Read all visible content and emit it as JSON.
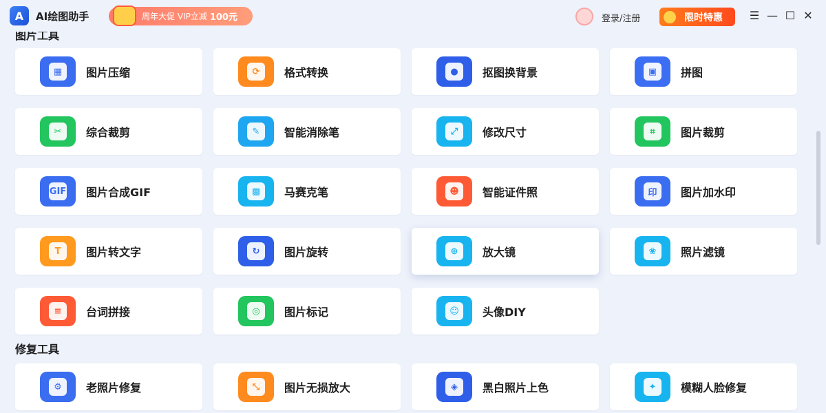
{
  "app": {
    "logo_letter": "A",
    "title": "AI绘图助手",
    "promo_text": "周年大促 VIP立减",
    "promo_amount": "100元",
    "login_label": "登录/注册",
    "offer_label": "限时特惠"
  },
  "window_controls": {
    "menu": "☰",
    "minimize": "—",
    "maximize": "☐",
    "close": "✕"
  },
  "sections": [
    {
      "title": "图片工具",
      "items": [
        {
          "label": "图片压缩",
          "icon": "file-compress-icon",
          "color": "#3a6df0",
          "glyph": "▦"
        },
        {
          "label": "格式转换",
          "icon": "format-convert-icon",
          "color": "#ff8a1e",
          "glyph": "⟳"
        },
        {
          "label": "抠图换背景",
          "icon": "cutout-icon",
          "color": "#2f5fe8",
          "glyph": "●"
        },
        {
          "label": "拼图",
          "icon": "puzzle-icon",
          "color": "#3b6ef2",
          "glyph": "▣"
        },
        {
          "label": "综合裁剪",
          "icon": "scissors-icon",
          "color": "#22c55e",
          "glyph": "✂"
        },
        {
          "label": "智能消除笔",
          "icon": "eraser-icon",
          "color": "#1ea7f0",
          "glyph": "✎"
        },
        {
          "label": "修改尺寸",
          "icon": "resize-icon",
          "color": "#18b4f0",
          "glyph": "⤢"
        },
        {
          "label": "图片裁剪",
          "icon": "crop-icon",
          "color": "#22c55e",
          "glyph": "⌗"
        },
        {
          "label": "图片合成GIF",
          "icon": "gif-icon",
          "color": "#3a6df0",
          "glyph": "GIF"
        },
        {
          "label": "马赛克笔",
          "icon": "mosaic-icon",
          "color": "#18b4f0",
          "glyph": "▩"
        },
        {
          "label": "智能证件照",
          "icon": "id-photo-icon",
          "color": "#ff5a36",
          "glyph": "☻"
        },
        {
          "label": "图片加水印",
          "icon": "watermark-icon",
          "color": "#3a6df0",
          "glyph": "印"
        },
        {
          "label": "图片转文字",
          "icon": "ocr-text-icon",
          "color": "#ff9a1e",
          "glyph": "T"
        },
        {
          "label": "图片旋转",
          "icon": "rotate-icon",
          "color": "#2f5fe8",
          "glyph": "↻"
        },
        {
          "label": "放大镜",
          "icon": "magnifier-icon",
          "color": "#18b4f0",
          "glyph": "⊕"
        },
        {
          "label": "照片滤镜",
          "icon": "filter-icon",
          "color": "#18b4f0",
          "glyph": "❀"
        },
        {
          "label": "台词拼接",
          "icon": "subtitle-icon",
          "color": "#ff5a36",
          "glyph": "≡"
        },
        {
          "label": "图片标记",
          "icon": "marker-icon",
          "color": "#22c55e",
          "glyph": "◎"
        },
        {
          "label": "头像DIY",
          "icon": "avatar-diy-icon",
          "color": "#18b4f0",
          "glyph": "☺"
        }
      ]
    },
    {
      "title": "修复工具",
      "items": [
        {
          "label": "老照片修复",
          "icon": "wrench-icon",
          "color": "#3a6df0",
          "glyph": "⚙"
        },
        {
          "label": "图片无损放大",
          "icon": "enlarge-icon",
          "color": "#ff8a1e",
          "glyph": "⤡"
        },
        {
          "label": "黑白照片上色",
          "icon": "colorize-icon",
          "color": "#2f5fe8",
          "glyph": "◈"
        },
        {
          "label": "模糊人脸修复",
          "icon": "sparkle-icon",
          "color": "#18b4f0",
          "glyph": "✦"
        }
      ]
    }
  ]
}
